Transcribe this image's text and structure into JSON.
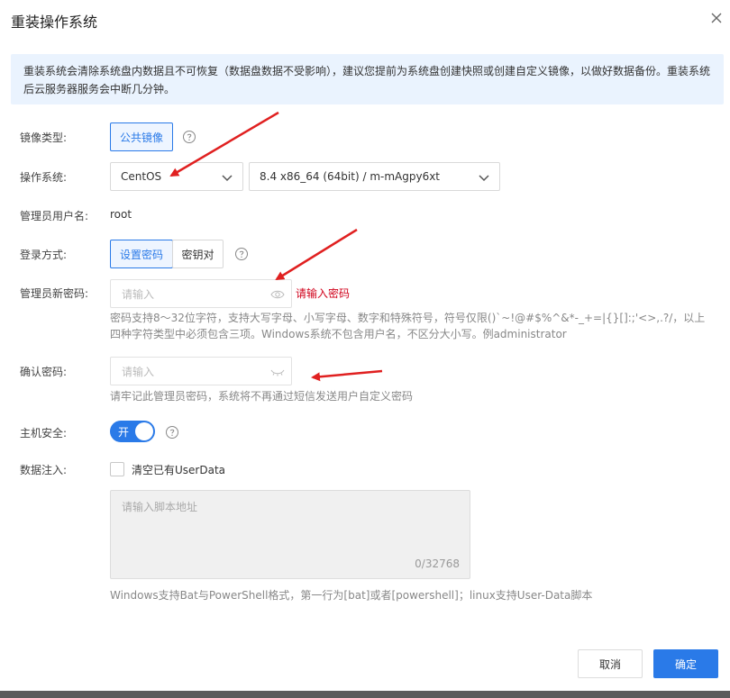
{
  "dialog": {
    "title": "重装操作系统",
    "notice": "重装系统会清除系统盘内数据且不可恢复（数据盘数据不受影响），建议您提前为系统盘创建快照或创建自定义镜像，以做好数据备份。重装系统后云服务器服务会中断几分钟。"
  },
  "form": {
    "image_type": {
      "label": "镜像类型:",
      "value": "公共镜像"
    },
    "os": {
      "label": "操作系统:",
      "distro": "CentOS",
      "version": "8.4 x86_64 (64bit) / m-mAgpy6xt"
    },
    "admin_user": {
      "label": "管理员用户名:",
      "value": "root"
    },
    "login_method": {
      "label": "登录方式:",
      "options": [
        "设置密码",
        "密钥对"
      ],
      "selected": "设置密码"
    },
    "new_password": {
      "label": "管理员新密码:",
      "placeholder": "请输入",
      "error": "请输入密码",
      "hint_line1": "密码支持8～32位字符，支持大写字母、小写字母、数字和特殊符号，符号仅限()`~!@#$%^&*-_+=|{}[]:;'<>,.?/，以上",
      "hint_line2": "四种字符类型中必须包含三项。Windows系统不包含用户名，不区分大小写。例administrator"
    },
    "confirm_password": {
      "label": "确认密码:",
      "placeholder": "请输入",
      "hint": "请牢记此管理员密码，系统将不再通过短信发送用户自定义密码"
    },
    "host_security": {
      "label": "主机安全:",
      "toggle_text": "开",
      "enabled": true
    },
    "user_data": {
      "label": "数据注入:",
      "checkbox_label": "清空已有UserData",
      "checked": false,
      "placeholder": "请输入脚本地址",
      "counter": "0/32768",
      "hint": "Windows支持Bat与PowerShell格式，第一行为[bat]或者[powershell]；linux支持User-Data脚本"
    }
  },
  "footer": {
    "cancel_label": "取消",
    "confirm_label": "确定"
  },
  "colors": {
    "accent": "#2a7ae8",
    "notice_bg": "#eaf3fe",
    "error": "#d0021b",
    "annotation_arrow": "#e02020"
  },
  "icons": [
    "close-icon",
    "help-icon",
    "chevron-down-icon",
    "eye-icon",
    "eye-closed-icon"
  ]
}
